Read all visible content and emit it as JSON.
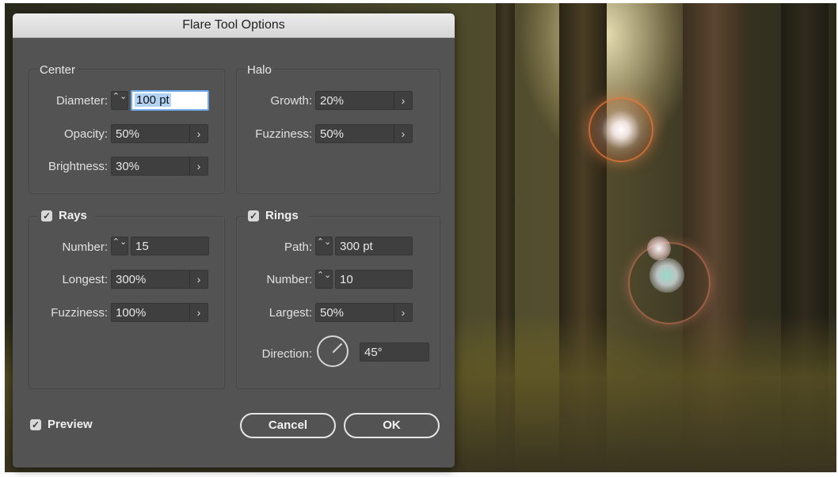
{
  "dialog": {
    "title": "Flare Tool Options",
    "center": {
      "title": "Center",
      "diameter": {
        "label": "Diameter:",
        "value": "100 pt"
      },
      "opacity": {
        "label": "Opacity:",
        "value": "50%"
      },
      "brightness": {
        "label": "Brightness:",
        "value": "30%"
      }
    },
    "halo": {
      "title": "Halo",
      "growth": {
        "label": "Growth:",
        "value": "20%"
      },
      "fuzziness": {
        "label": "Fuzziness:",
        "value": "50%"
      }
    },
    "rays": {
      "title": "Rays",
      "checked": true,
      "number": {
        "label": "Number:",
        "value": "15"
      },
      "longest": {
        "label": "Longest:",
        "value": "300%"
      },
      "fuzziness": {
        "label": "Fuzziness:",
        "value": "100%"
      }
    },
    "rings": {
      "title": "Rings",
      "checked": true,
      "path": {
        "label": "Path:",
        "value": "300 pt"
      },
      "number": {
        "label": "Number:",
        "value": "10"
      },
      "largest": {
        "label": "Largest:",
        "value": "50%"
      },
      "direction": {
        "label": "Direction:",
        "value": "45°",
        "angle_degrees": 45
      }
    },
    "preview": {
      "label": "Preview",
      "checked": true
    },
    "buttons": {
      "cancel": "Cancel",
      "ok": "OK"
    }
  },
  "icons": {
    "checkmark": "✓",
    "stepper": "⌃⌄",
    "chevron": "›"
  },
  "colors": {
    "dialog_bg": "#535353",
    "field_bg": "#3f3f3f",
    "focus_ring": "#6ea8e6",
    "selection": "#b3d3f5"
  }
}
